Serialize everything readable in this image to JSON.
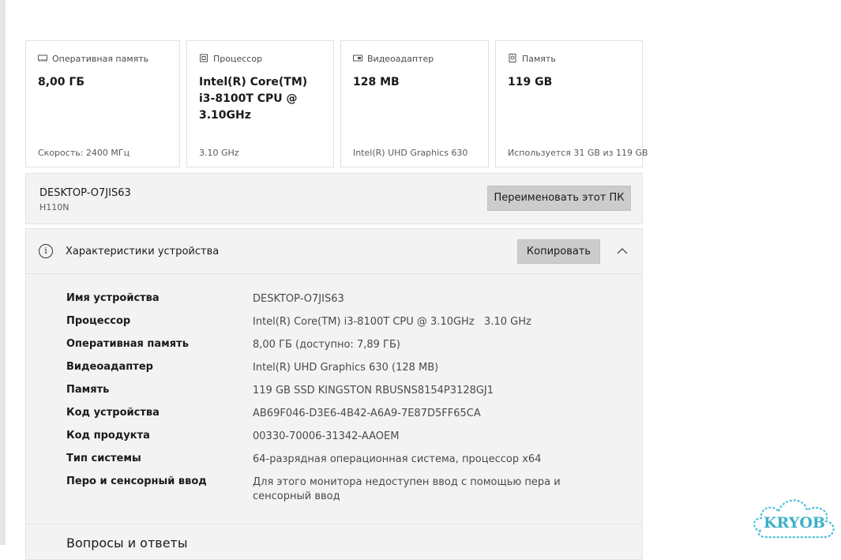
{
  "cards": [
    {
      "icon": "memory-chip-icon",
      "label": "Оперативная память",
      "value": "8,00 ГБ",
      "sub": "Скорость: 2400 МГц"
    },
    {
      "icon": "processor-icon",
      "label": "Процессор",
      "value": "Intel(R) Core(TM) i3-8100T CPU @ 3.10GHz",
      "sub": "3.10 GHz"
    },
    {
      "icon": "video-adapter-icon",
      "label": "Видеоадаптер",
      "value": "128 MB",
      "sub": "Intel(R) UHD Graphics 630"
    },
    {
      "icon": "storage-drive-icon",
      "label": "Память",
      "value": "119 GB",
      "sub": "Используется 31 GB из 119 GB"
    }
  ],
  "device": {
    "name": "DESKTOP-O7JIS63",
    "model": "H110N",
    "rename_label": "Переименовать этот ПК"
  },
  "specs": {
    "title": "Характеристики устройства",
    "copy_label": "Копировать",
    "rows": [
      {
        "key": "Имя устройства",
        "value": "DESKTOP-O7JIS63"
      },
      {
        "key": "Процессор",
        "value": "Intel(R) Core(TM) i3-8100T CPU @ 3.10GHz   3.10 GHz"
      },
      {
        "key": "Оперативная память",
        "value": "8,00 ГБ (доступно: 7,89 ГБ)"
      },
      {
        "key": "Видеоадаптер",
        "value": "Intel(R) UHD Graphics 630 (128 MB)"
      },
      {
        "key": "Память",
        "value": "119 GB SSD KINGSTON RBUSNS8154P3128GJ1"
      },
      {
        "key": "Код устройства",
        "value": "AB69F046-D3E6-4B42-A6A9-7E87D5FF65CA"
      },
      {
        "key": "Код продукта",
        "value": "00330-70006-31342-AAOEM"
      },
      {
        "key": "Тип системы",
        "value": "64-разрядная операционная система, процессор x64"
      },
      {
        "key": "Перо и сенсорный ввод",
        "value": "Для этого монитора недоступен ввод с помощью пера и сенсорный ввод"
      }
    ]
  },
  "faq_title": "Вопросы и ответы",
  "watermark": "KRYOB",
  "colors": {
    "button_bg": "#cccccc",
    "panel_bg": "#f3f3f3",
    "border": "#e0e0e0",
    "watermark": "#4fc3d8"
  }
}
